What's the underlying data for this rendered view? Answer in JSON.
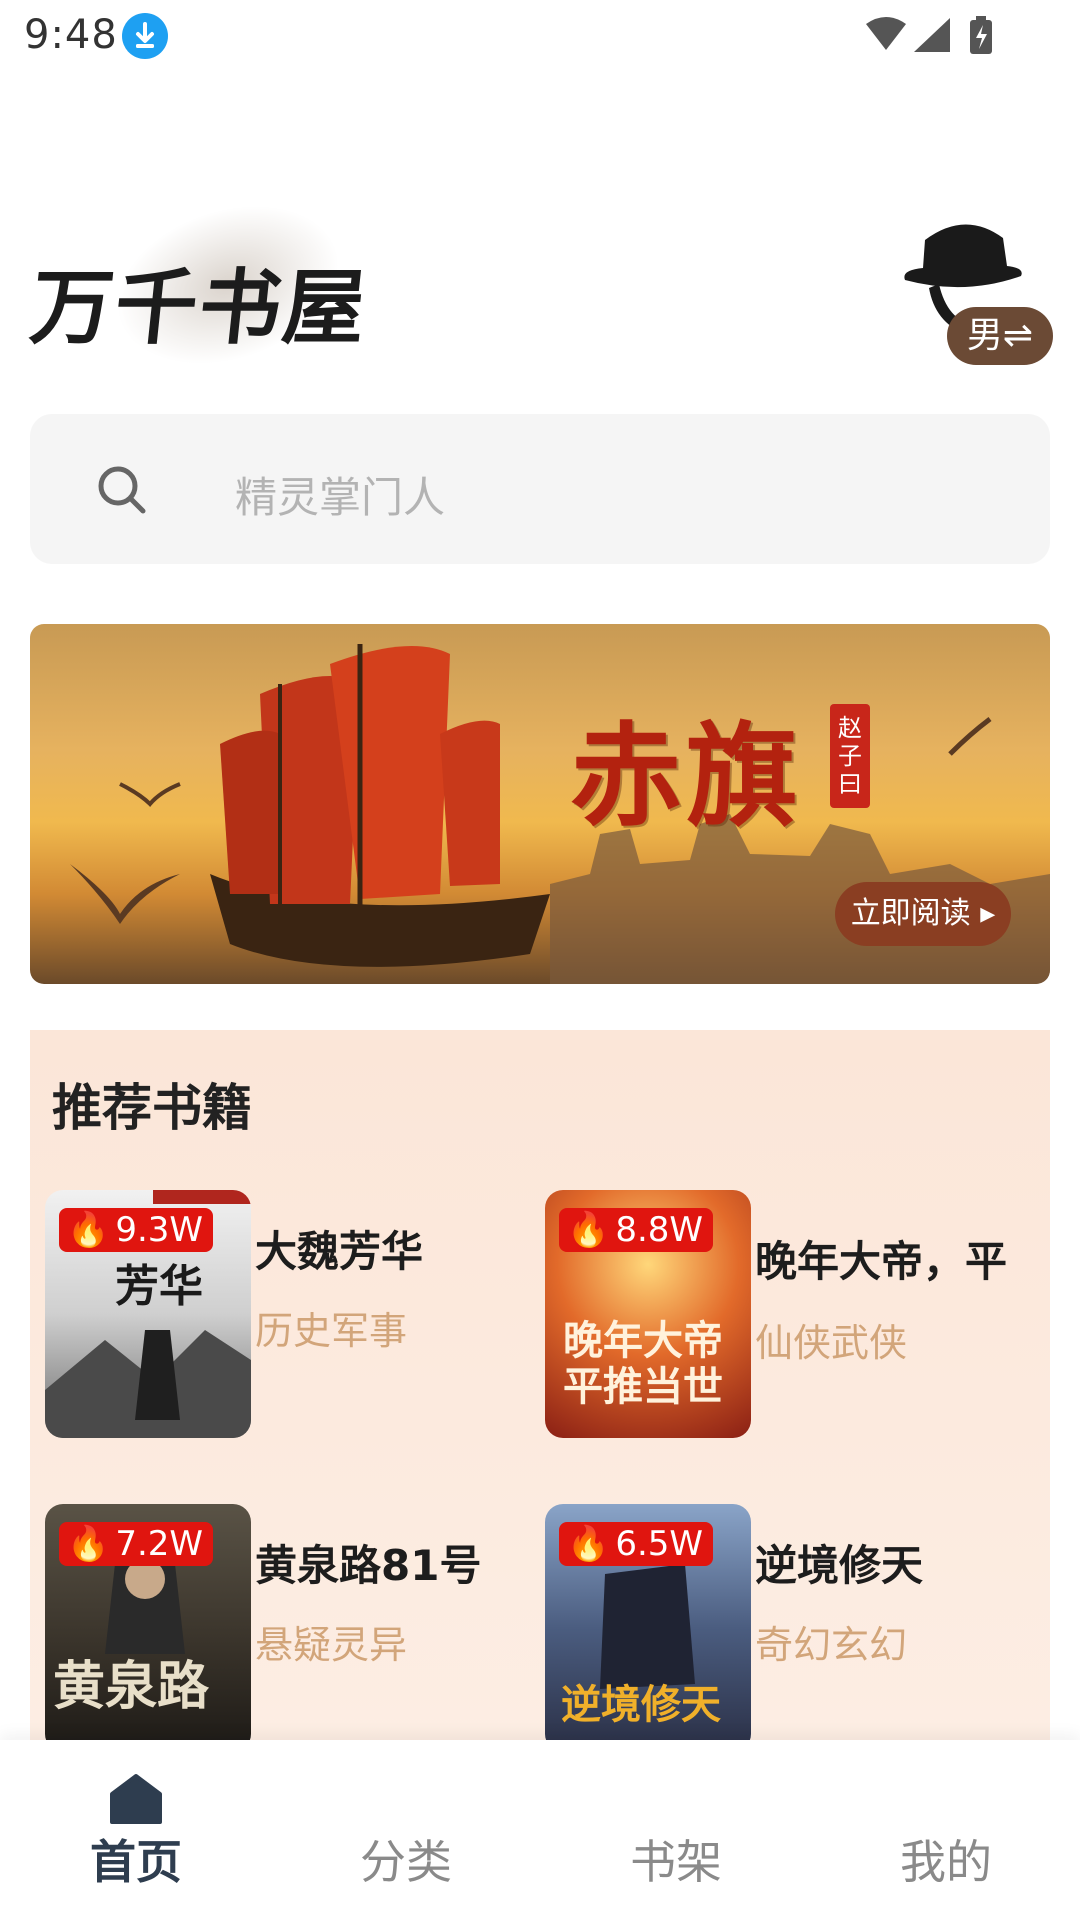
{
  "status_bar": {
    "time": "9:48",
    "icons": [
      "download-icon",
      "wifi-icon",
      "signal-icon",
      "battery-charging-icon"
    ]
  },
  "header": {
    "logo_text": "万千书屋",
    "gender_toggle": "男⇌"
  },
  "search": {
    "placeholder": "精灵掌门人"
  },
  "banner": {
    "title": "赤旗",
    "author": "赵子曰",
    "cta_label": "立即阅读 ▸"
  },
  "recommended": {
    "title": "推荐书籍",
    "books": [
      {
        "title": "大魏芳华",
        "genre": "历史军事",
        "heat": "9.3W"
      },
      {
        "title": "晚年大帝，平",
        "genre": "仙侠武侠",
        "heat": "8.8W"
      },
      {
        "title": "黄泉路81号",
        "genre": "悬疑灵异",
        "heat": "7.2W"
      },
      {
        "title": "逆境修天",
        "genre": "奇幻玄幻",
        "heat": "6.5W"
      }
    ]
  },
  "nav": {
    "items": [
      {
        "label": "首页",
        "active": true
      },
      {
        "label": "分类",
        "active": false
      },
      {
        "label": "书架",
        "active": false
      },
      {
        "label": "我的",
        "active": false
      }
    ]
  },
  "colors": {
    "heat_badge": "#e0150f",
    "genre_text": "#d2a57a",
    "panel_bg": "#fbe6d8",
    "nav_active": "#2e3d4f"
  }
}
